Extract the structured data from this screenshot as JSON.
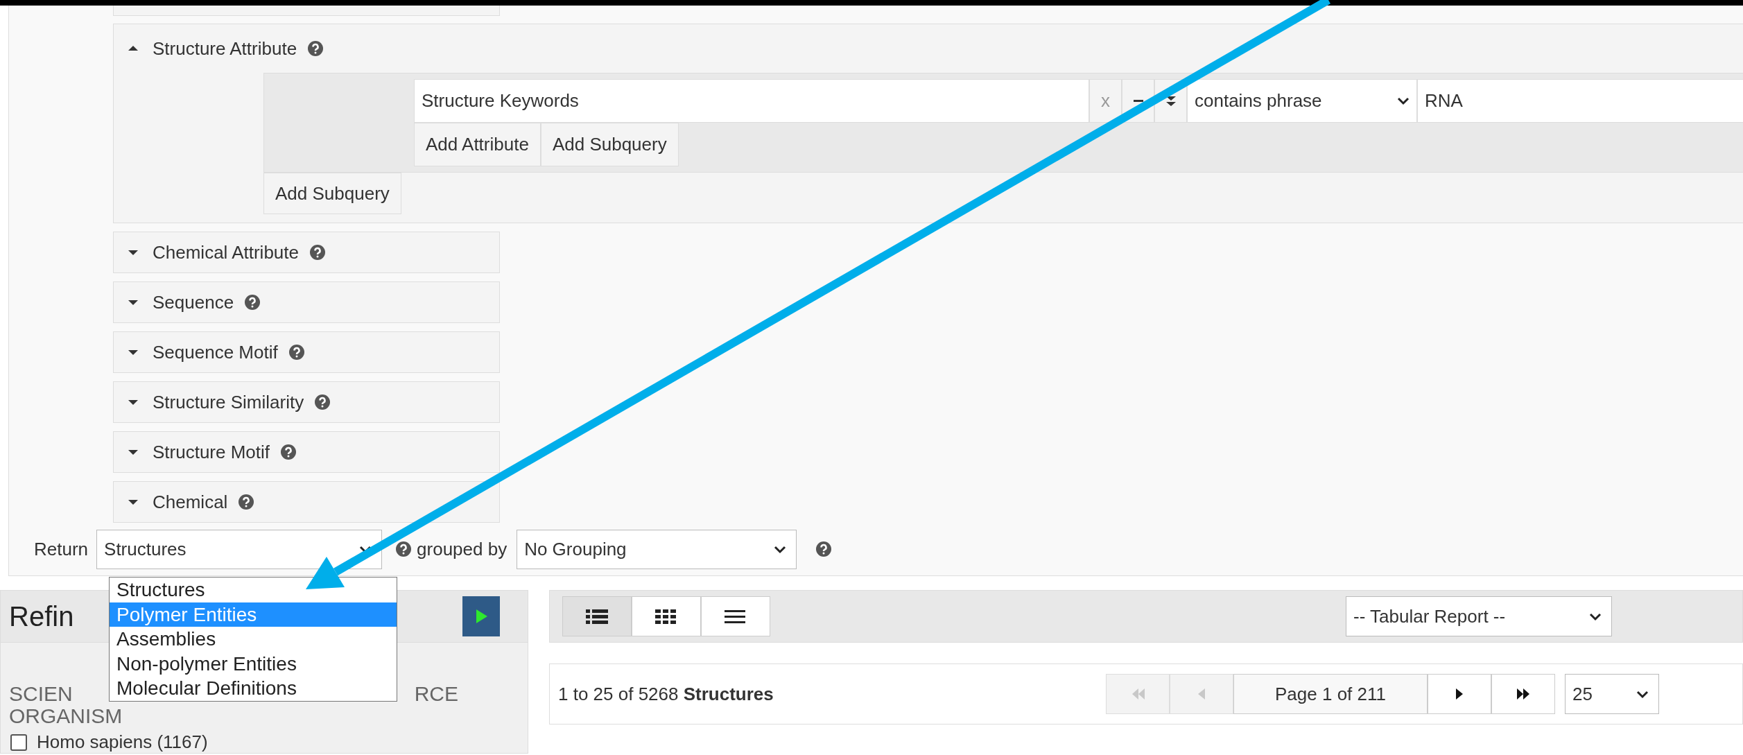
{
  "attribute_panel": {
    "title": "Structure Attribute",
    "expanded": true,
    "query_row": {
      "attribute": "Structure Keywords",
      "remove": "x",
      "operator": "contains phrase",
      "value": "RNA"
    },
    "inner_buttons": [
      "Add Attribute",
      "Add Subquery"
    ],
    "outer_buttons": [
      "Add Subquery"
    ]
  },
  "panels": [
    {
      "title": "Chemical Attribute",
      "expanded": false
    },
    {
      "title": "Sequence",
      "expanded": false
    },
    {
      "title": "Sequence Motif",
      "expanded": false
    },
    {
      "title": "Structure Similarity",
      "expanded": false
    },
    {
      "title": "Structure Motif",
      "expanded": false
    },
    {
      "title": "Chemical",
      "expanded": false
    }
  ],
  "return_row": {
    "label": "Return",
    "return_select": "Structures",
    "grouped_label": "grouped by",
    "group_select": "No Grouping"
  },
  "return_dropdown": {
    "options": [
      {
        "label": "Structures",
        "selected": false
      },
      {
        "label": "Polymer Entities",
        "selected": true
      },
      {
        "label": "Assemblies",
        "selected": false
      },
      {
        "label": "Non-polymer Entities",
        "selected": false
      },
      {
        "label": "Molecular Definitions",
        "selected": false
      }
    ]
  },
  "refine": {
    "title": "Refin",
    "facet_title": {
      "line_1_left": "SCIEN",
      "line_1_right": "RCE",
      "line_2": "ORGANISM"
    },
    "facets": [
      {
        "label": "Homo sapiens (1167)",
        "checked": false
      }
    ]
  },
  "view_modes": [
    {
      "kind": "detailed",
      "selected": true
    },
    {
      "kind": "grid",
      "selected": false
    },
    {
      "kind": "list",
      "selected": false
    }
  ],
  "report_select": "-- Tabular Report --",
  "results": {
    "summary": "1 to 25 of 5268 **Structures**",
    "page_label": "Page 1 of 211",
    "per_page": "25",
    "pager": [
      {
        "kind": "first",
        "disabled": true
      },
      {
        "kind": "prev",
        "disabled": true
      },
      {
        "kind": "label",
        "disabled": false
      },
      {
        "kind": "next",
        "disabled": false
      },
      {
        "kind": "last",
        "disabled": false
      }
    ]
  }
}
